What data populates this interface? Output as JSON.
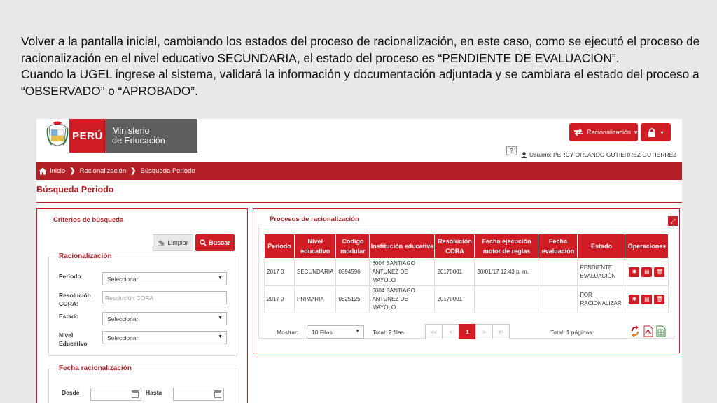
{
  "slide": {
    "paragraph1": "Volver a la pantalla inicial, cambiando los estados del proceso de racionalización, en este caso, como se ejecutó el proceso de racionalización en el nivel educativo SECUNDARIA, el estado del proceso es “PENDIENTE DE EVALUACION”.",
    "paragraph2": "Cuando la UGEL ingrese al sistema, validará la información y documentación adjuntada y se cambiara el estado del proceso a “OBSERVADO” o “APROBADO”."
  },
  "header": {
    "logo_peru": "PERÚ",
    "logo_ministerio_line1": "Ministerio",
    "logo_ministerio_line2": "de Educación",
    "racionalizacion_menu": "Racionalización",
    "help": "?",
    "user": "Usuario: PERCY ORLANDO GUTIERREZ GUTIERREZ"
  },
  "breadcrumb": [
    "Inicio",
    "Racionalización",
    "Búsqueda Periodo"
  ],
  "page_title": "Búsqueda Periodo",
  "criteria": {
    "title": "Criterios de búsqueda",
    "limpiar": "Limpiar",
    "buscar": "Buscar",
    "racionalizacion_legend": "Racionalización",
    "periodo_label": "Periodo",
    "periodo_value": "Seleccionar",
    "resolucion_label_1": "Resolución",
    "resolucion_label_2": "CORA:",
    "resolucion_placeholder": "Resolución CORA",
    "estado_label": "Estado",
    "estado_value": "Seleccionar",
    "nivel_label_1": "Nivel",
    "nivel_label_2": "Educativo",
    "nivel_value": "Seleccionar",
    "fecha_legend": "Fecha racionalización",
    "desde_label": "Desde",
    "hasta_label": "Hasta"
  },
  "processes": {
    "title": "Procesos de racionalización",
    "headers": [
      "Periodo",
      "Nivel educativo",
      "Codigo modular",
      "Institución educativa",
      "Resolución CORA",
      "Fecha ejecución motor de reglas",
      "Fecha evaluación",
      "Estado",
      "Operaciones"
    ],
    "rows": [
      {
        "periodo": "2017 0",
        "nivel": "SECUNDARIA",
        "codigo": "0694596",
        "institucion": "6004 SANTIAGO ANTUNEZ DE MAYOLO",
        "resolucion": "20170001",
        "fecha_ejec": "30/01/17 12:43 p. m.",
        "fecha_eval": "",
        "estado": "PENDIENTE EVALUACIÓN"
      },
      {
        "periodo": "2017 0",
        "nivel": "PRIMARIA",
        "codigo": "0825125",
        "institucion": "6004 SANTIAGO ANTUNEZ DE MAYOLO",
        "resolucion": "20170001",
        "fecha_ejec": "",
        "fecha_eval": "",
        "estado": "POR RACIONALIZAR"
      }
    ],
    "mostrar_label": "Mostrar:",
    "mostrar_value": "10 Filas",
    "total_filas": "Total: 2 filas",
    "pager": [
      "<<",
      "<",
      "1",
      ">",
      ">>"
    ],
    "total_paginas": "Total: 1 páginas"
  },
  "colors": {
    "accent": "#d01c24",
    "breadcrumb": "#b21f24"
  }
}
